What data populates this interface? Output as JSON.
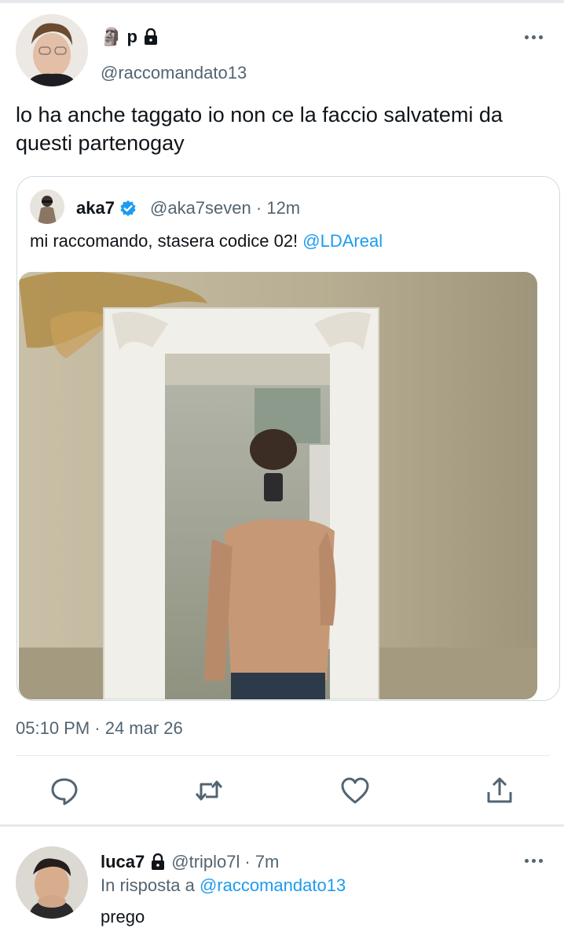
{
  "main_tweet": {
    "display_name": "🗿 p",
    "handle": "@raccomandato13",
    "text": "lo ha anche taggato io non ce la faccio salvatemi da questi partenogay",
    "timestamp": "05:10 PM · 24 mar 26"
  },
  "quoted_tweet": {
    "display_name": "aka7",
    "handle": "@aka7seven",
    "separator": "·",
    "time": "12m",
    "text": "mi raccomando, stasera codice 02!",
    "mention": "@LDAreal"
  },
  "actions": [
    "reply-icon",
    "retweet-icon",
    "like-icon",
    "share-icon"
  ],
  "reply": {
    "display_name": "luca7",
    "handle": "@triplo7l",
    "separator": "·",
    "time": "7m",
    "in_reply_prefix": "In risposta a",
    "in_reply_to": "@raccomandato13",
    "text": "prego"
  },
  "colors": {
    "accent": "#1d9bf0",
    "secondary_text": "#536471",
    "border": "#cfd9de"
  }
}
